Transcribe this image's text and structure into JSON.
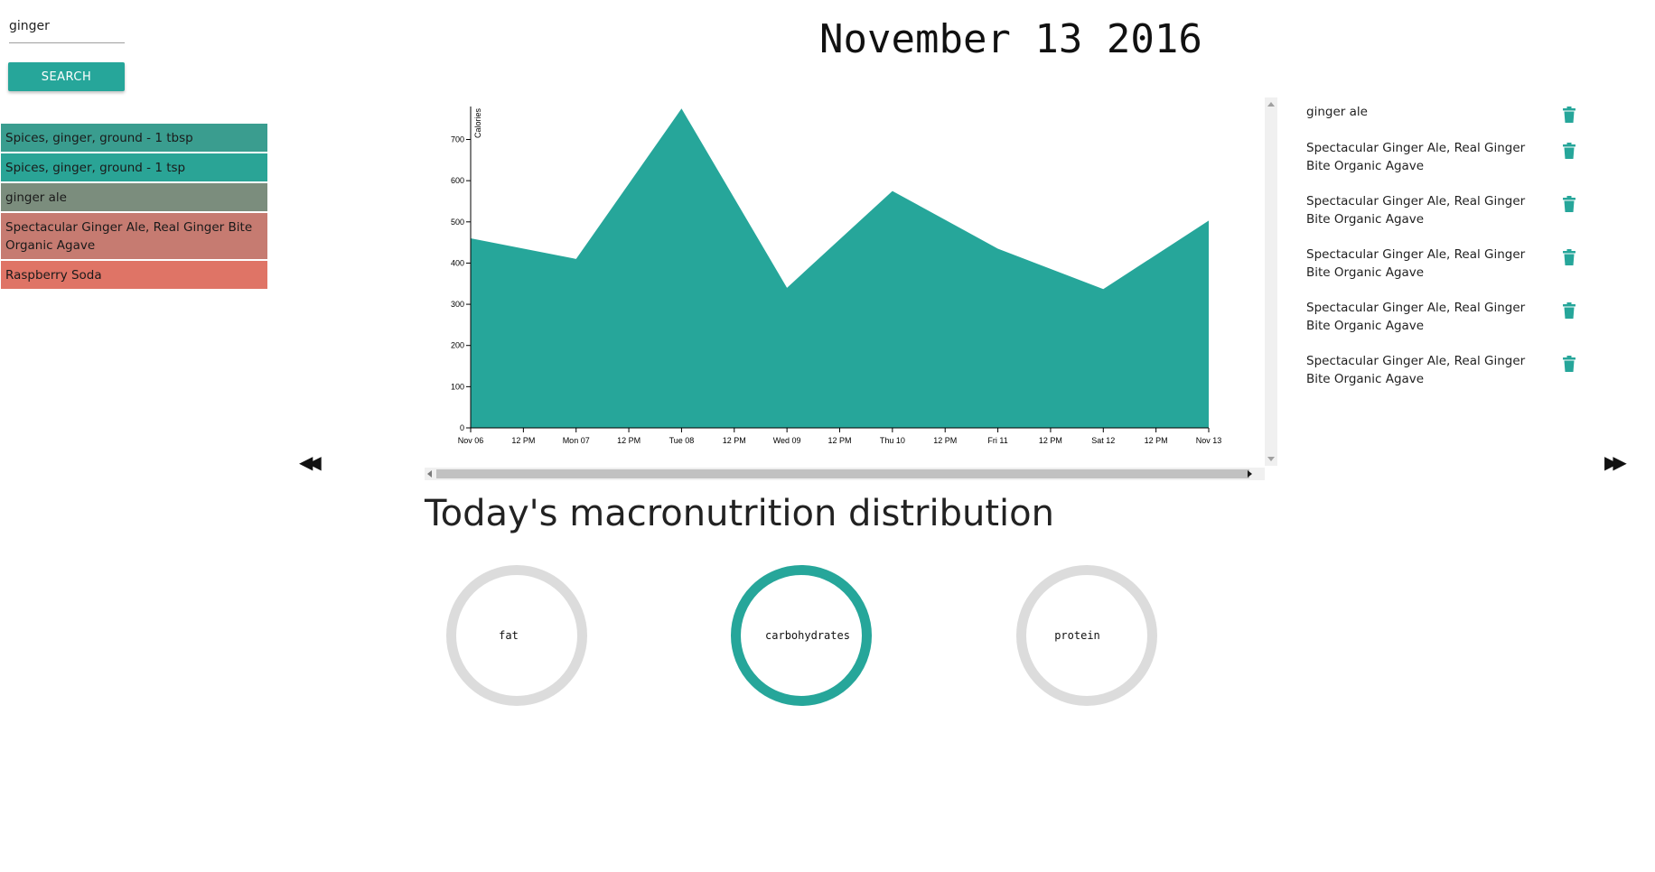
{
  "search": {
    "value": "ginger",
    "button_label": "SEARCH"
  },
  "results": [
    {
      "label": "Spices, ginger, ground - 1 tbsp",
      "color": "#3a9d8f"
    },
    {
      "label": "Spices, ginger, ground - 1 tsp",
      "color": "#2aa496"
    },
    {
      "label": "ginger ale",
      "color": "#7b8d7d"
    },
    {
      "label": "Spectacular Ginger Ale, Real Ginger Bite Organic Agave",
      "color": "#c67b71"
    },
    {
      "label": "Raspberry Soda",
      "color": "#df7466"
    }
  ],
  "date_title": "November 13 2016",
  "navigation": {
    "prev_icon": "rewind-icon",
    "next_icon": "fast-forward-icon",
    "prev_glyph": "◀◀",
    "next_glyph": "▶▶"
  },
  "chart_data": {
    "type": "area",
    "ylabel": "Calories",
    "x": [
      "Nov 06",
      "Mon 07",
      "Tue 08",
      "Wed 09",
      "Thu 10",
      "Fri 11",
      "Sat 12",
      "Nov 13"
    ],
    "values": [
      460,
      410,
      775,
      340,
      575,
      435,
      337,
      503
    ],
    "x_ticks": [
      "Nov 06",
      "12 PM",
      "Mon 07",
      "12 PM",
      "Tue 08",
      "12 PM",
      "Wed 09",
      "12 PM",
      "Thu 10",
      "12 PM",
      "Fri 11",
      "12 PM",
      "Sat 12",
      "12 PM",
      "Nov 13"
    ],
    "y_ticks": [
      0,
      100,
      200,
      300,
      400,
      500,
      600,
      700
    ],
    "ylim": [
      0,
      780
    ],
    "color": "#26a69a",
    "grid": false
  },
  "food_log": [
    {
      "label": "ginger ale",
      "icon": "trash-icon"
    },
    {
      "label": "Spectacular Ginger Ale, Real Ginger Bite Organic Agave",
      "icon": "trash-icon"
    },
    {
      "label": "Spectacular Ginger Ale, Real Ginger Bite Organic Agave",
      "icon": "trash-icon"
    },
    {
      "label": "Spectacular Ginger Ale, Real Ginger Bite Organic Agave",
      "icon": "trash-icon"
    },
    {
      "label": "Spectacular Ginger Ale, Real Ginger Bite Organic Agave",
      "icon": "trash-icon"
    },
    {
      "label": "Spectacular Ginger Ale, Real Ginger Bite Organic Agave",
      "icon": "trash-icon"
    }
  ],
  "macro": {
    "heading": "Today's macronutrition distribution",
    "rings": [
      {
        "label": "fat",
        "active": false
      },
      {
        "label": "carbohydrates",
        "active": true
      },
      {
        "label": "protein",
        "active": false
      }
    ],
    "active_color": "#26a69a",
    "inactive_color": "#dcdcdc"
  },
  "colors": {
    "accent": "#26a69a",
    "trash": "#26a69a"
  }
}
